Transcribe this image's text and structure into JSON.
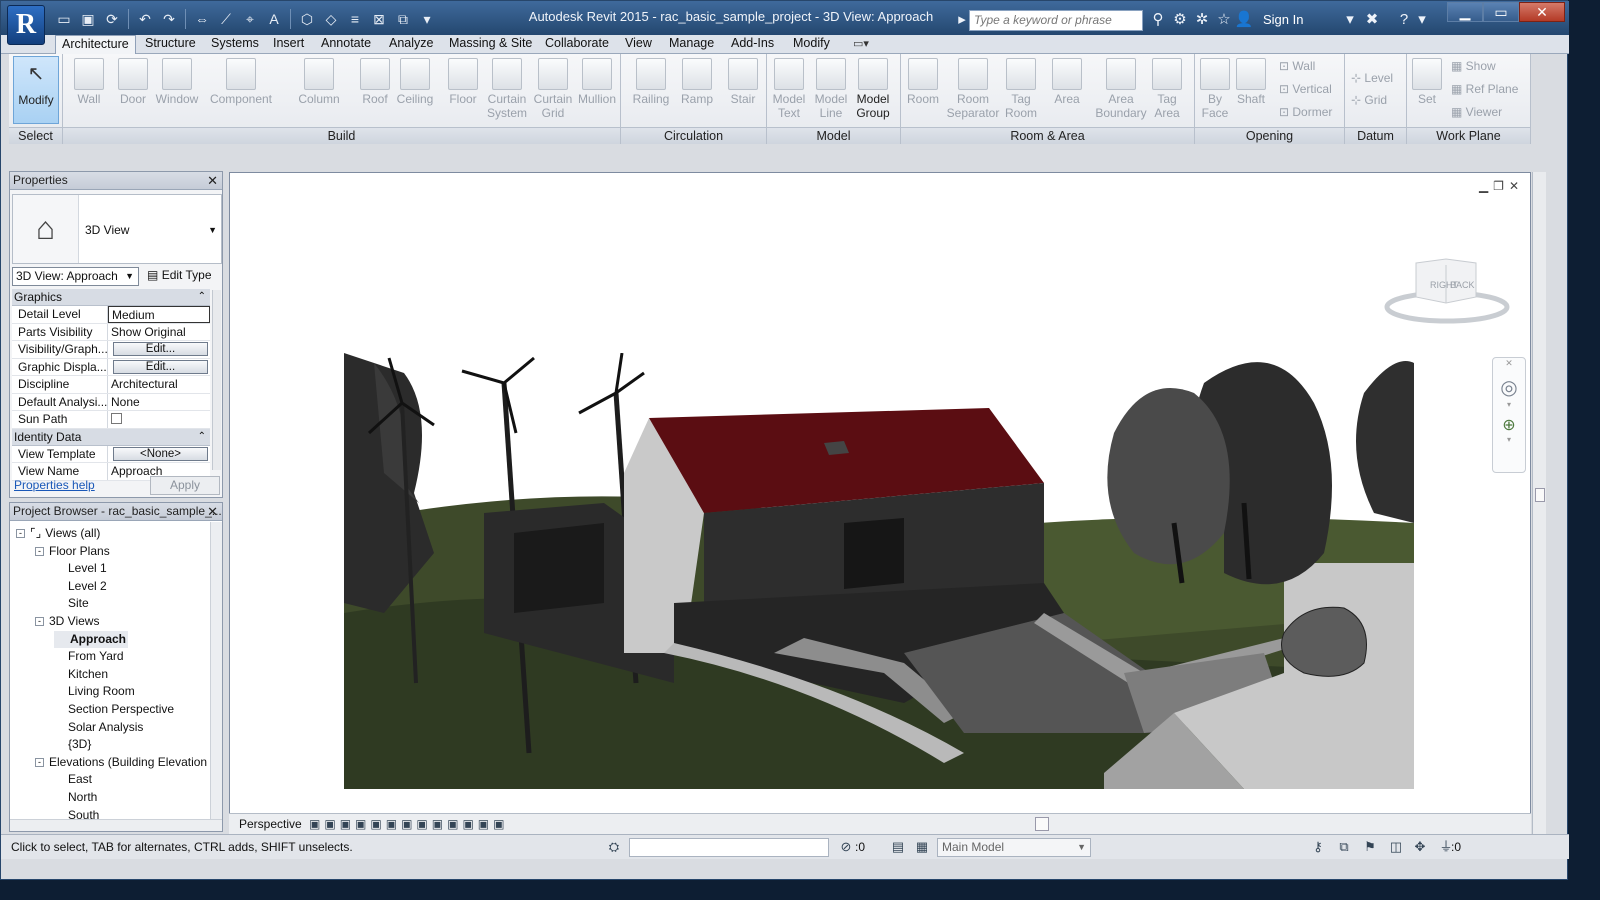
{
  "app": {
    "title": "Autodesk Revit 2015 -     rac_basic_sample_project - 3D View: Approach",
    "logo_letter": "R",
    "search_placeholder": "Type a keyword or phrase",
    "sign_in": "Sign In"
  },
  "qat_icons": [
    "open-icon",
    "save-icon",
    "sync-icon",
    "undo-icon",
    "redo-icon",
    "measure-icon",
    "dimension-icon",
    "tag-icon",
    "text-icon",
    "3d-view-icon",
    "section-icon",
    "thin-lines-icon",
    "close-hidden-icon",
    "switch-windows-icon",
    "customize-icon"
  ],
  "tabs": [
    "Architecture",
    "Structure",
    "Systems",
    "Insert",
    "Annotate",
    "Analyze",
    "Massing & Site",
    "Collaborate",
    "View",
    "Manage",
    "Add-Ins",
    "Modify"
  ],
  "ribbon": {
    "select": {
      "modify": "Modify",
      "label": "Select"
    },
    "build": {
      "label": "Build",
      "buttons": [
        "Wall",
        "Door",
        "Window",
        "Component",
        "Column",
        "Roof",
        "Ceiling",
        "Floor",
        "Curtain System",
        "Curtain Grid",
        "Mullion"
      ]
    },
    "circulation": {
      "label": "Circulation",
      "buttons": [
        "Railing",
        "Ramp",
        "Stair"
      ]
    },
    "model": {
      "label": "Model",
      "buttons": [
        "Model Text",
        "Model Line",
        "Model Group"
      ]
    },
    "room_area": {
      "label": "Room & Area",
      "buttons": [
        "Room",
        "Room Separator",
        "Tag Room",
        "Area",
        "Area Boundary",
        "Tag Area"
      ]
    },
    "opening": {
      "label": "Opening",
      "buttons": [
        "By Face",
        "Shaft"
      ],
      "small": [
        "Wall",
        "Vertical",
        "Dormer"
      ]
    },
    "datum": {
      "label": "Datum",
      "small": [
        "Level",
        "Grid"
      ]
    },
    "work_plane": {
      "label": "Work Plane",
      "buttons": [
        "Set"
      ],
      "small": [
        "Show",
        "Ref  Plane",
        "Viewer"
      ]
    }
  },
  "properties": {
    "title": "Properties",
    "type_name": "3D View",
    "view_selector": "3D View: Approach",
    "edit_type": "Edit Type",
    "sections": [
      {
        "name": "Graphics",
        "rows": [
          {
            "k": "Detail Level",
            "v": "Medium"
          },
          {
            "k": "Parts Visibility",
            "v": "Show Original"
          },
          {
            "k": "Visibility/Graph...",
            "v": "Edit..."
          },
          {
            "k": "Graphic Displa...",
            "v": "Edit..."
          },
          {
            "k": "Discipline",
            "v": "Architectural"
          },
          {
            "k": "Default Analysi...",
            "v": "None"
          },
          {
            "k": "Sun Path",
            "v": ""
          }
        ]
      },
      {
        "name": "Identity Data",
        "rows": [
          {
            "k": "View Template",
            "v": "<None>"
          },
          {
            "k": "View Name",
            "v": "Approach"
          }
        ]
      }
    ],
    "help": "Properties help",
    "apply": "Apply"
  },
  "browser": {
    "title": "Project Browser - rac_basic_sample_...",
    "nodes": [
      {
        "t": "Views (all)",
        "d": 0,
        "ex": "-"
      },
      {
        "t": "Floor Plans",
        "d": 1,
        "ex": "-"
      },
      {
        "t": "Level 1",
        "d": 2
      },
      {
        "t": "Level 2",
        "d": 2
      },
      {
        "t": "Site",
        "d": 2
      },
      {
        "t": "3D Views",
        "d": 1,
        "ex": "-"
      },
      {
        "t": "Approach",
        "d": 2,
        "sel": true
      },
      {
        "t": "From Yard",
        "d": 2
      },
      {
        "t": "Kitchen",
        "d": 2
      },
      {
        "t": "Living Room",
        "d": 2
      },
      {
        "t": "Section Perspective",
        "d": 2
      },
      {
        "t": "Solar Analysis",
        "d": 2
      },
      {
        "t": "{3D}",
        "d": 2
      },
      {
        "t": "Elevations (Building Elevation",
        "d": 1,
        "ex": "-"
      },
      {
        "t": "East",
        "d": 2
      },
      {
        "t": "North",
        "d": 2
      },
      {
        "t": "South",
        "d": 2
      }
    ]
  },
  "view": {
    "viewbar_mode": "Perspective",
    "viewcube": {
      "right": "RIGHT",
      "back": "BACK"
    }
  },
  "status": {
    "text": "Click to select, TAB for alternates, CTRL adds, SHIFT unselects.",
    "worksets": ":0",
    "model": "Main Model",
    "filter": ":0"
  }
}
